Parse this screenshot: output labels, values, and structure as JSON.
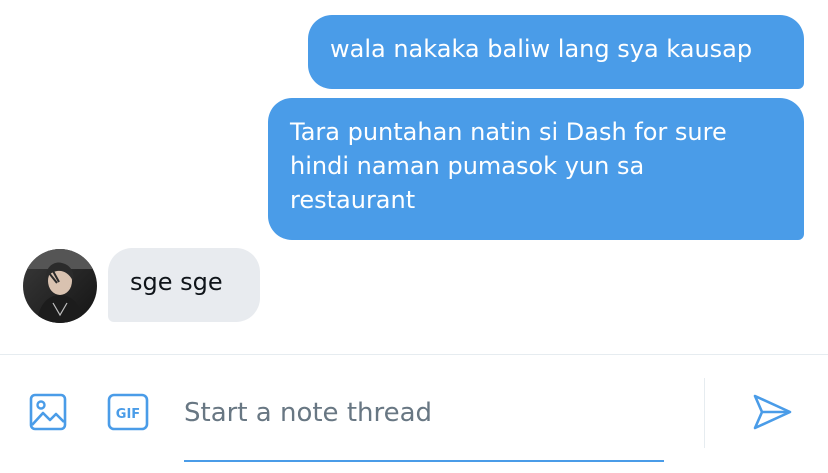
{
  "conversation": {
    "messages": [
      {
        "direction": "sent",
        "text": "wala nakaka baliw lang sya kausap"
      },
      {
        "direction": "sent",
        "text": "Tara puntahan natin si Dash for sure\nhindi naman pumasok yun sa\nrestaurant"
      },
      {
        "direction": "received",
        "text": "sge sge"
      }
    ]
  },
  "composer": {
    "placeholder": "Start a note thread",
    "gif_label": "GIF",
    "icons": {
      "media": "image-icon",
      "gif": "gif-icon",
      "send": "send-icon"
    }
  },
  "colors": {
    "accent": "#4a9ce8",
    "received_bubble": "#e8ebef",
    "placeholder": "#687783",
    "divider": "#e6ecf0"
  }
}
